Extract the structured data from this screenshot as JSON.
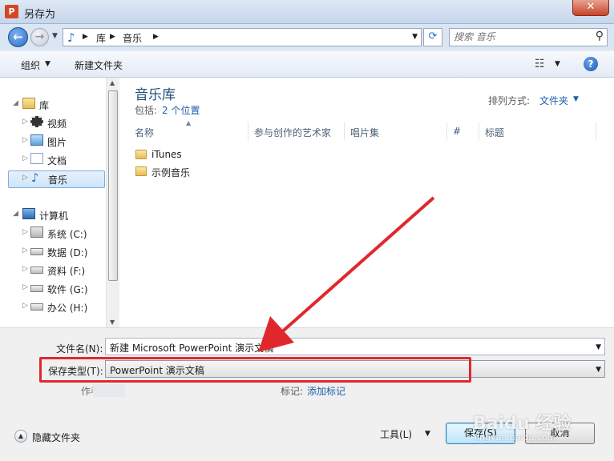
{
  "window": {
    "title": "另存为",
    "close_label": "✕",
    "app_icon_letter": "P"
  },
  "address": {
    "segments": [
      "库",
      "音乐"
    ],
    "search_placeholder": "搜索 音乐"
  },
  "toolbar": {
    "organize": "组织",
    "new_folder": "新建文件夹",
    "help": "?"
  },
  "nav": {
    "libraries": {
      "label": "库",
      "items": [
        {
          "label": "视频",
          "icon": "video-icon"
        },
        {
          "label": "图片",
          "icon": "picture-icon"
        },
        {
          "label": "文档",
          "icon": "document-icon"
        },
        {
          "label": "音乐",
          "icon": "music-icon",
          "selected": true
        }
      ]
    },
    "computer": {
      "label": "计算机",
      "drives": [
        {
          "label": "系统 (C:)"
        },
        {
          "label": "数据 (D:)"
        },
        {
          "label": "资料 (F:)"
        },
        {
          "label": "软件 (G:)"
        },
        {
          "label": "办公 (H:)"
        }
      ]
    }
  },
  "library": {
    "title": "音乐库",
    "includes_label": "包括:",
    "includes_link": "2 个位置",
    "arrange_label": "排列方式:",
    "arrange_value": "文件夹"
  },
  "columns": [
    "名称",
    "参与创作的艺术家",
    "唱片集",
    "#",
    "标题"
  ],
  "folders": [
    "iTunes",
    "示例音乐"
  ],
  "form": {
    "filename_label": "文件名(N):",
    "filename_value": "新建 Microsoft PowerPoint 演示文稿",
    "savetype_label": "保存类型(T):",
    "savetype_value": "PowerPoint 演示文稿",
    "author_label": "作者:",
    "tags_label": "标记:",
    "tags_link": "添加标记"
  },
  "footer": {
    "hide_folders": "隐藏文件夹",
    "tools": "工具(L)",
    "save": "保存(S)",
    "cancel": "取消"
  },
  "annotation": {
    "color": "#e0282c"
  },
  "watermark": {
    "text": "Baidu 经验",
    "sub": "jingyan.baidu.com"
  }
}
